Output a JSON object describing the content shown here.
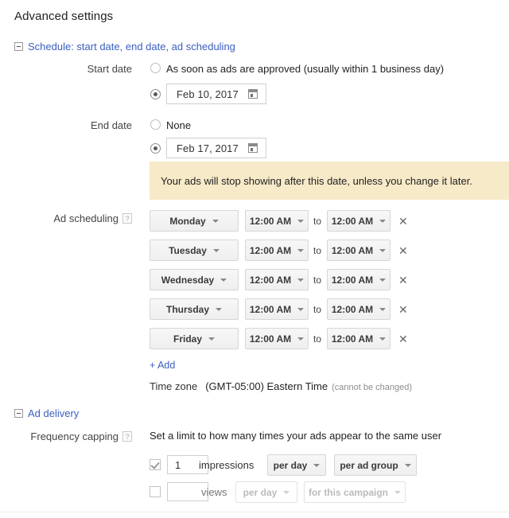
{
  "page": {
    "title": "Advanced settings"
  },
  "sections": {
    "schedule": {
      "label": "Schedule: start date, end date, ad scheduling",
      "expander_icon": "collapse-minus-icon"
    },
    "ad_delivery": {
      "label": "Ad delivery",
      "expander_icon": "collapse-minus-icon"
    }
  },
  "start_date": {
    "label": "Start date",
    "option_asap": "As soon as ads are approved (usually within 1 business day)",
    "asap_selected": false,
    "date_value": "Feb 10, 2017",
    "date_selected": true,
    "calendar_icon": "calendar-icon"
  },
  "end_date": {
    "label": "End date",
    "option_none": "None",
    "none_selected": false,
    "date_value": "Feb 17, 2017",
    "date_selected": true,
    "calendar_icon": "calendar-icon",
    "warning": "Your ads will stop showing after this date, unless you change it later.",
    "warning_color": "#f7eac8"
  },
  "ad_scheduling": {
    "label": "Ad scheduling",
    "help_icon": "help-question-icon",
    "to_label": "to",
    "remove_icon": "close-x-icon",
    "rows": [
      {
        "day": "Monday",
        "start_time": "12:00 AM",
        "end_time": "12:00 AM"
      },
      {
        "day": "Tuesday",
        "start_time": "12:00 AM",
        "end_time": "12:00 AM"
      },
      {
        "day": "Wednesday",
        "start_time": "12:00 AM",
        "end_time": "12:00 AM"
      },
      {
        "day": "Thursday",
        "start_time": "12:00 AM",
        "end_time": "12:00 AM"
      },
      {
        "day": "Friday",
        "start_time": "12:00 AM",
        "end_time": "12:00 AM"
      }
    ],
    "add_link": "+ Add",
    "timezone_label": "Time zone",
    "timezone_value": "(GMT-05:00) Eastern Time",
    "timezone_note": "(cannot be changed)"
  },
  "frequency_capping": {
    "label": "Frequency capping",
    "help_icon": "help-question-icon",
    "description": "Set a limit to how many times your ads appear to the same user",
    "impressions_row": {
      "checked": true,
      "value": "1",
      "unit": "impressions",
      "period": "per day",
      "scope": "per ad group"
    },
    "views_row": {
      "checked": false,
      "value": "",
      "unit": "views",
      "period": "per day",
      "scope": "for this campaign",
      "disabled": true
    }
  },
  "colors": {
    "link": "#3b5fc0",
    "warning_bg": "#f7eac8",
    "text": "#222222",
    "muted": "#8c8c8c"
  }
}
